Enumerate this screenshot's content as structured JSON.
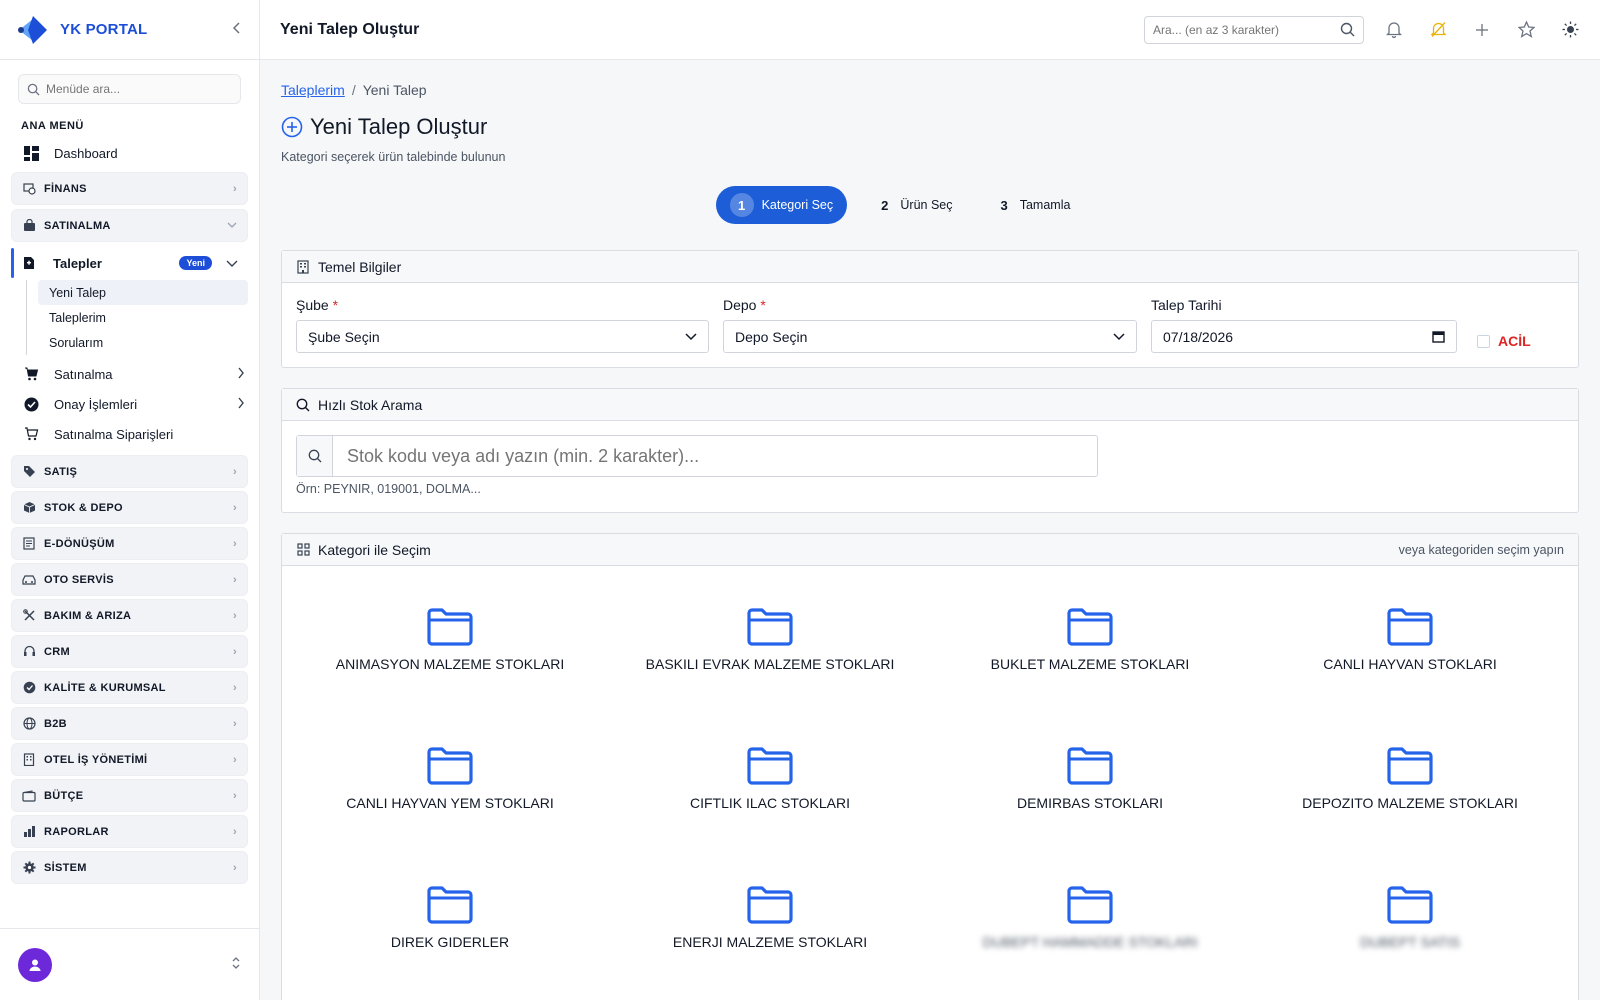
{
  "app": {
    "brand": "YK PORTAL",
    "brand_color": "#1d4ed8"
  },
  "sidebar": {
    "search_placeholder": "Menüde ara...",
    "section_title": "ANA MENÜ",
    "dashboard_label": "Dashboard",
    "groups_top": [
      {
        "label": "FİNANS",
        "icon": "finance-icon"
      },
      {
        "label": "SATINALMA",
        "icon": "bag-icon",
        "expanded": true
      }
    ],
    "talepler": {
      "label": "Talepler",
      "badge": "Yeni"
    },
    "talepler_sub": [
      {
        "label": "Yeni Talep",
        "active": true
      },
      {
        "label": "Taleplerim"
      },
      {
        "label": "Sorularım"
      }
    ],
    "satinalma_items": [
      {
        "label": "Satınalma",
        "icon": "cart-icon"
      },
      {
        "label": "Onay İşlemleri",
        "icon": "check-circle-icon"
      },
      {
        "label": "Satınalma Siparişleri",
        "icon": "cart-outline-icon"
      }
    ],
    "groups_bottom": [
      {
        "label": "SATIŞ",
        "icon": "tag-icon"
      },
      {
        "label": "STOK & DEPO",
        "icon": "box-icon"
      },
      {
        "label": "E-DÖNÜŞÜM",
        "icon": "document-icon"
      },
      {
        "label": "OTO SERVİS",
        "icon": "car-icon"
      },
      {
        "label": "BAKIM & ARIZA",
        "icon": "tools-icon"
      },
      {
        "label": "CRM",
        "icon": "headset-icon"
      },
      {
        "label": "KALİTE & KURUMSAL",
        "icon": "badge-icon"
      },
      {
        "label": "B2B",
        "icon": "globe-icon"
      },
      {
        "label": "OTEL İŞ YÖNETİMİ",
        "icon": "building-icon"
      },
      {
        "label": "BÜTÇE",
        "icon": "wallet-icon"
      },
      {
        "label": "RAPORLAR",
        "icon": "bar-chart-icon"
      },
      {
        "label": "SİSTEM",
        "icon": "gear-icon"
      }
    ]
  },
  "topbar": {
    "title": "Yeni Talep Oluştur",
    "search_placeholder": "Ara... (en az 3 karakter)"
  },
  "breadcrumb": {
    "link": "Taleplerim",
    "sep": "/",
    "current": "Yeni Talep"
  },
  "page": {
    "title": "Yeni Talep Oluştur",
    "subtitle": "Kategori seçerek ürün talebinde bulunun"
  },
  "steps": [
    {
      "num": "1",
      "label": "Kategori Seç",
      "active": true
    },
    {
      "num": "2",
      "label": "Ürün Seç"
    },
    {
      "num": "3",
      "label": "Tamamla"
    }
  ],
  "basic_info": {
    "title": "Temel Bilgiler",
    "sube_label": "Şube",
    "sube_value": "Şube Seçin",
    "depo_label": "Depo",
    "depo_value": "Depo Seçin",
    "date_label": "Talep Tarihi",
    "date_value": "07/18/2026",
    "acil_label": "ACİL",
    "required_mark": "*"
  },
  "quick_search": {
    "title": "Hızlı Stok Arama",
    "placeholder": "Stok kodu veya adı yazın (min. 2 karakter)...",
    "hint": "Örn: PEYNIR, 019001, DOLMA..."
  },
  "categories": {
    "title": "Kategori ile Seçim",
    "right_text": "veya kategoriden seçim yapın",
    "folder_color": "#2563eb",
    "items": [
      "ANIMASYON MALZEME STOKLARI",
      "BASKILI EVRAK MALZEME STOKLARI",
      "BUKLET MALZEME STOKLARI",
      "CANLI HAYVAN STOKLARI",
      "CANLI HAYVAN YEM STOKLARI",
      "CIFTLIK ILAC STOKLARI",
      "DEMIRBAS STOKLARI",
      "DEPOZITO MALZEME STOKLARI",
      "DIREK GIDERLER",
      "ENERJI MALZEME STOKLARI",
      "DUBEPT HAMMADDE STOKLARI",
      "DUBEPT SATIS"
    ]
  }
}
